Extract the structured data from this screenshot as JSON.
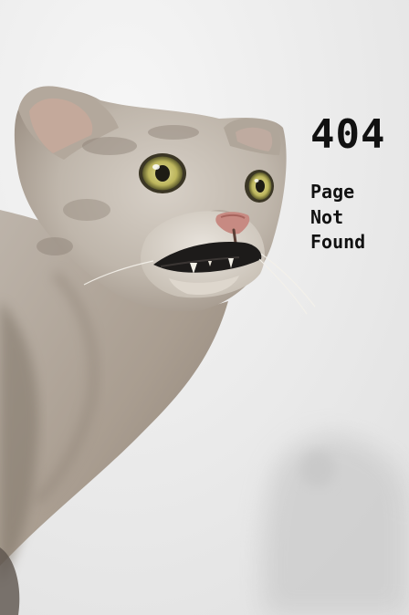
{
  "error": {
    "code": "404",
    "message": "Page Not Found"
  },
  "colors": {
    "background": "#ededed",
    "text": "#111111",
    "fur": "#b7aea4",
    "eye": "#c8c06a"
  },
  "image": {
    "subject": "taxidermy-cat-icon"
  }
}
